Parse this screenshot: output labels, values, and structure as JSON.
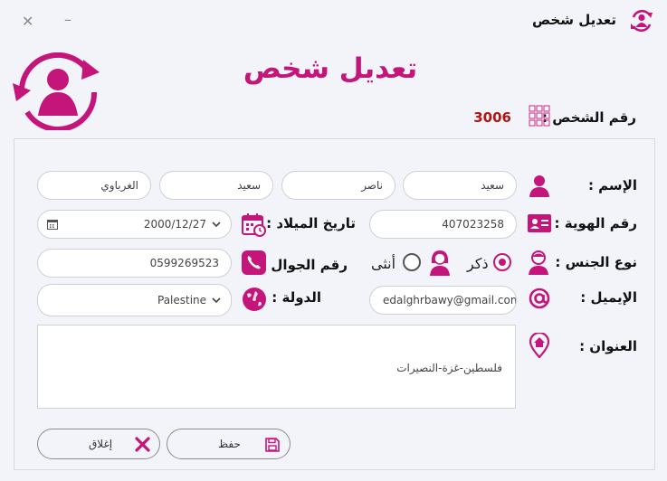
{
  "window": {
    "title": "تعديل شخص",
    "minimize_glyph": "–",
    "close_glyph": "✕",
    "app_icon": "person-sync-icon"
  },
  "header": {
    "title": "تعديل شخص",
    "logo_icon": "person-sync-icon",
    "person_id_label": "رقم الشخص :",
    "person_id_value": "3006",
    "id_icon": "grid-blocks-icon"
  },
  "form": {
    "name": {
      "label": "الإسم :",
      "first": "سعيد",
      "second": "ناصر",
      "third": "سعيد",
      "last": "الغرباوي"
    },
    "national_id": {
      "label": "رقم الهوية :",
      "value": "407023258"
    },
    "birth_date": {
      "label": "تاريخ الميلاد :",
      "value": "2000/12/27"
    },
    "gender": {
      "label": "نوع الجنس :",
      "male": "ذكر",
      "female": "أنثى",
      "selected": "ذكر"
    },
    "phone": {
      "label": "رقم الجوال :",
      "value": "0599269523"
    },
    "email": {
      "label": "الإيميل :",
      "value": "edalghrbawy@gmail.com"
    },
    "country": {
      "label": "الدولة :",
      "selected": "Palestine"
    },
    "address": {
      "label": "العنوان :",
      "value": "فلسطين-غزة-النصيرات"
    }
  },
  "buttons": {
    "save": "حفظ",
    "close": "إغلاق"
  },
  "colors": {
    "accent": "#c4157b",
    "id_value": "#b01616",
    "background": "#f2f4f9"
  }
}
